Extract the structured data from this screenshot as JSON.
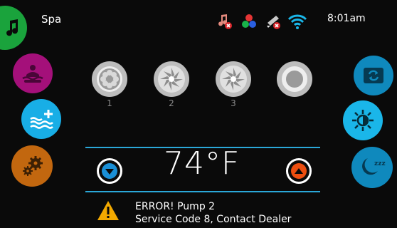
{
  "header": {
    "title": "Spa",
    "time": "8:01am"
  },
  "status_icons": [
    "music-off-icon",
    "colors-icon",
    "light-off-icon",
    "wifi-icon"
  ],
  "left_buttons": [
    {
      "name": "music-button",
      "icon": "music-note-icon",
      "color": "#1aa33c"
    },
    {
      "name": "hot-tub-button",
      "icon": "hot-tub-icon",
      "color": "#a4107a"
    },
    {
      "name": "heat-button",
      "icon": "water-heat-icon",
      "color": "#18aee6"
    },
    {
      "name": "settings-button",
      "icon": "gears-icon",
      "color": "#c2670f"
    }
  ],
  "right_buttons": [
    {
      "name": "invert-button",
      "icon": "invert-screen-icon",
      "color": "#0f89bd"
    },
    {
      "name": "light-button",
      "icon": "sun-icon",
      "color": "#1ab6e9"
    },
    {
      "name": "sleep-button",
      "icon": "sleep-moon-icon",
      "color": "#0f89bd"
    }
  ],
  "pumps": [
    {
      "label": "1"
    },
    {
      "label": "2"
    },
    {
      "label": "3"
    },
    {
      "label": ""
    }
  ],
  "temperature": {
    "value": "74°F",
    "down_color": "#1a8fd6",
    "up_color": "#ec4e10"
  },
  "error": {
    "line1": "ERROR! Pump 2",
    "line2": "Service Code 8, Contact Dealer",
    "warning_color": "#f2a900"
  }
}
